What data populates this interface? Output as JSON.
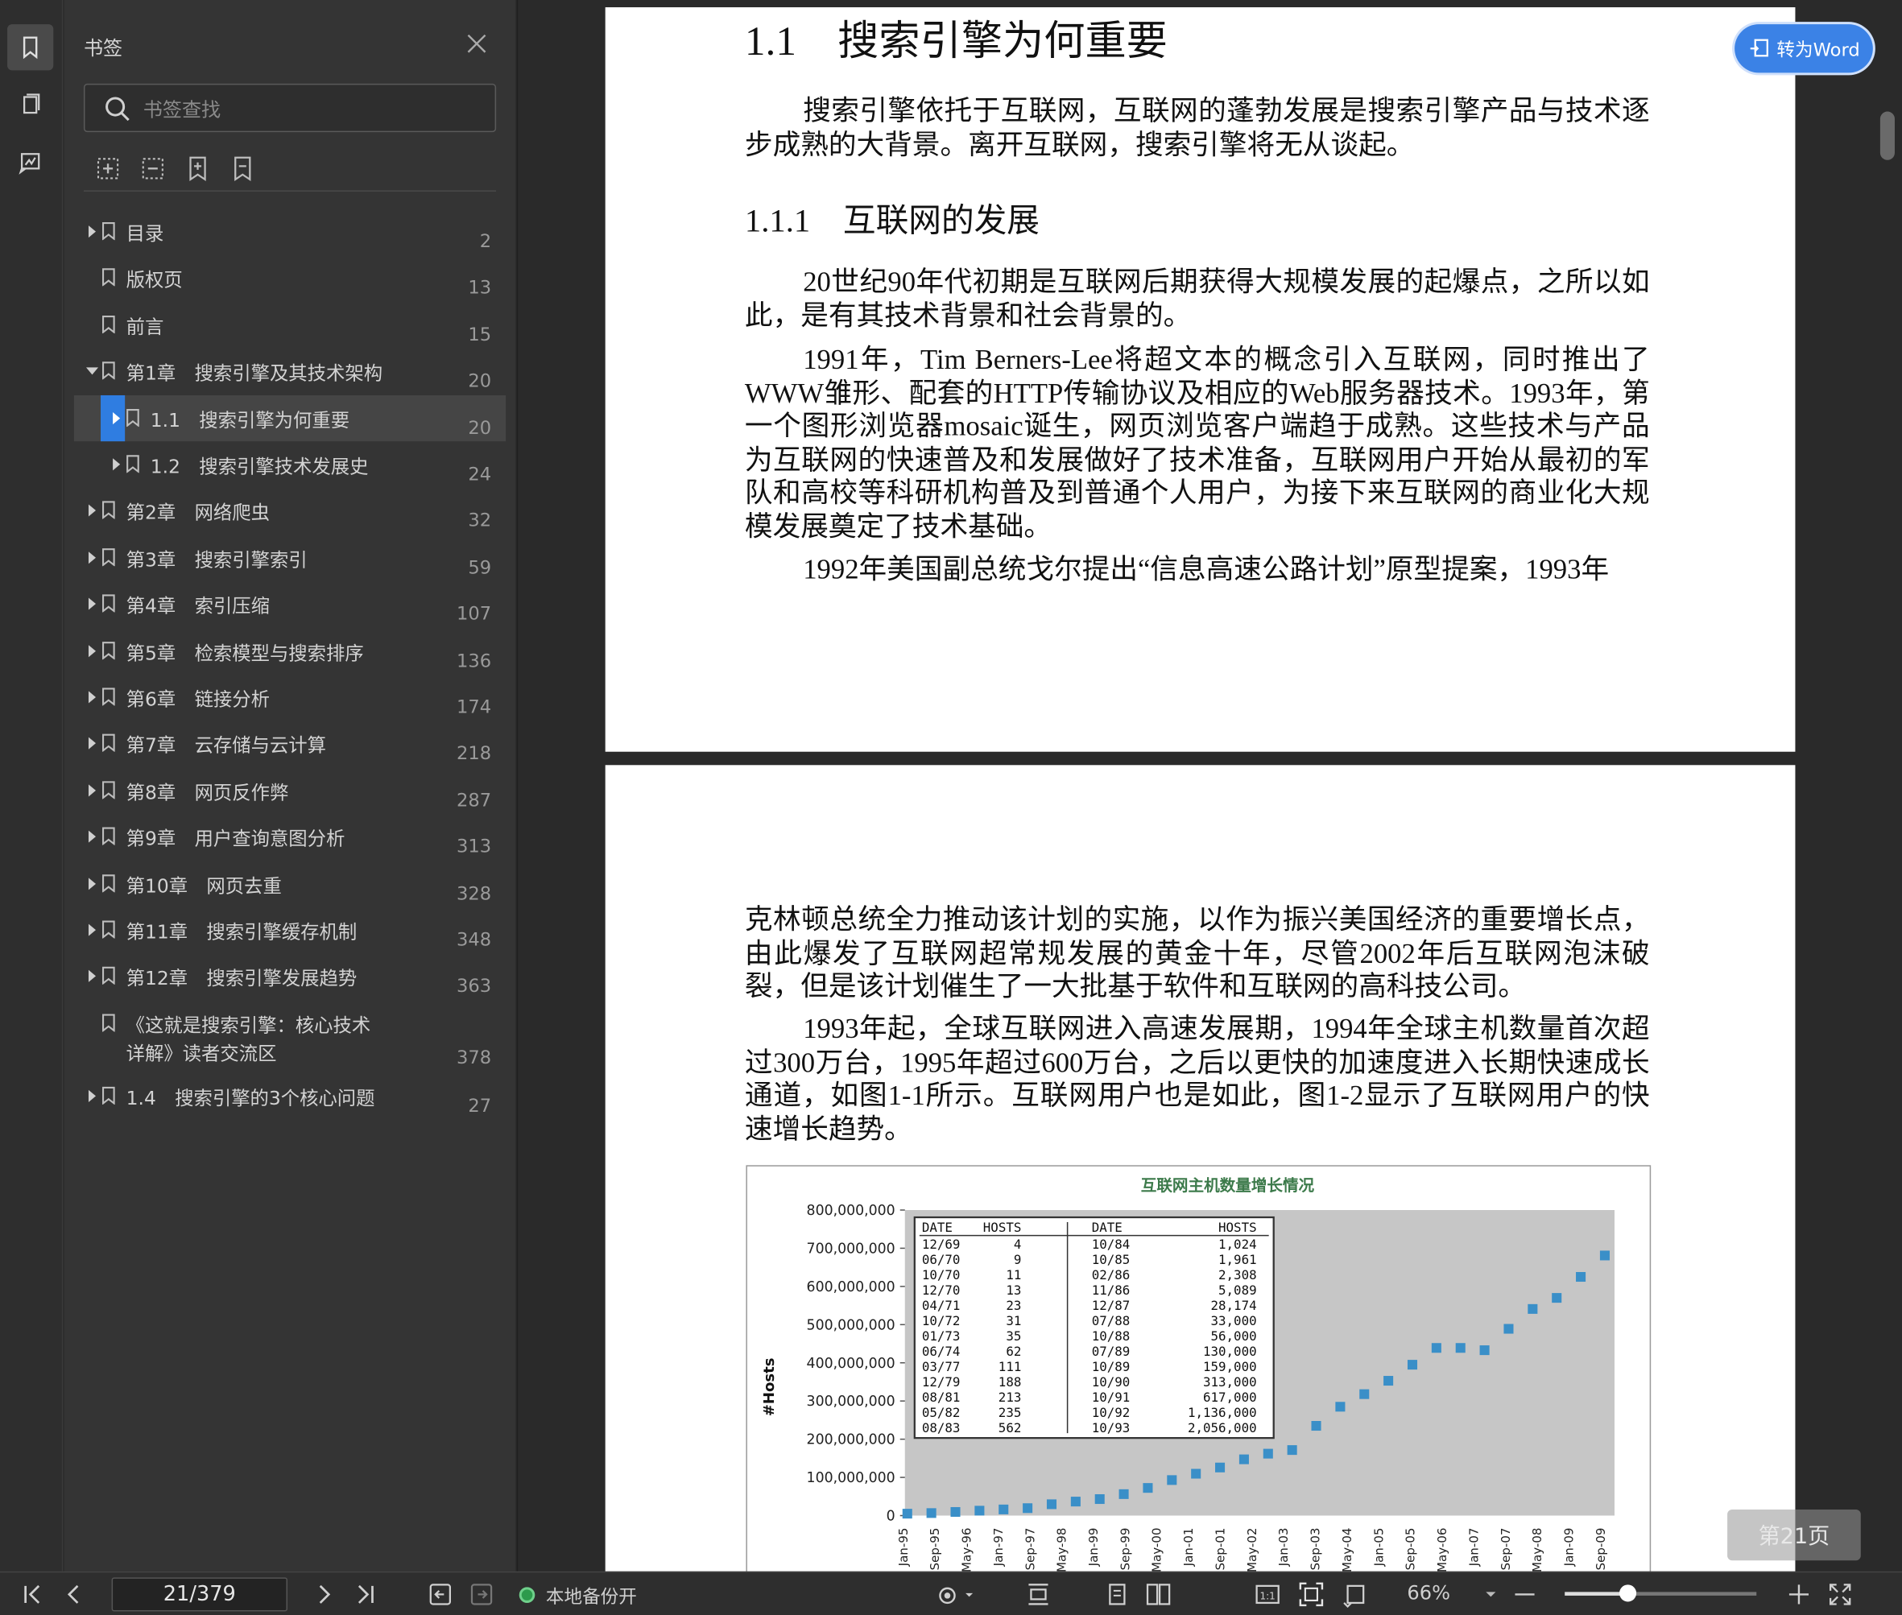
{
  "sidebar": {
    "title": "书签",
    "search_placeholder": "书签查找",
    "items": [
      {
        "label": "目录",
        "page": "2",
        "level": 0,
        "expand": "collapsed"
      },
      {
        "label": "版权页",
        "page": "13",
        "level": 0,
        "expand": "none"
      },
      {
        "label": "前言",
        "page": "15",
        "level": 0,
        "expand": "none"
      },
      {
        "label": "第1章　搜索引擎及其技术架构",
        "page": "20",
        "level": 0,
        "expand": "expanded"
      },
      {
        "label": "1.1　搜索引擎为何重要",
        "page": "20",
        "level": 1,
        "expand": "collapsed",
        "selected": true
      },
      {
        "label": "1.2　搜索引擎技术发展史",
        "page": "24",
        "level": 1,
        "expand": "collapsed"
      },
      {
        "label": "第2章　网络爬虫",
        "page": "32",
        "level": 0,
        "expand": "collapsed"
      },
      {
        "label": "第3章　搜索引擎索引",
        "page": "59",
        "level": 0,
        "expand": "collapsed"
      },
      {
        "label": "第4章　索引压缩",
        "page": "107",
        "level": 0,
        "expand": "collapsed"
      },
      {
        "label": "第5章　检索模型与搜索排序",
        "page": "136",
        "level": 0,
        "expand": "collapsed"
      },
      {
        "label": "第6章　链接分析",
        "page": "174",
        "level": 0,
        "expand": "collapsed"
      },
      {
        "label": "第7章　云存储与云计算",
        "page": "218",
        "level": 0,
        "expand": "collapsed"
      },
      {
        "label": "第8章　网页反作弊",
        "page": "287",
        "level": 0,
        "expand": "collapsed"
      },
      {
        "label": "第9章　用户查询意图分析",
        "page": "313",
        "level": 0,
        "expand": "collapsed"
      },
      {
        "label": "第10章　网页去重",
        "page": "328",
        "level": 0,
        "expand": "collapsed"
      },
      {
        "label": "第11章　搜索引擎缓存机制",
        "page": "348",
        "level": 0,
        "expand": "collapsed"
      },
      {
        "label": "第12章　搜索引擎发展趋势",
        "page": "363",
        "level": 0,
        "expand": "collapsed"
      },
      {
        "label": "《这就是搜索引擎：核心技术",
        "label2": "详解》读者交流区",
        "page": "378",
        "level": 0,
        "expand": "none"
      },
      {
        "label": "1.4　搜索引擎的3个核心问题",
        "page": "27",
        "level": 0,
        "expand": "collapsed"
      }
    ]
  },
  "document": {
    "heading1": "1.1　搜索引擎为何重要",
    "p1": "搜索引擎依托于互联网，互联网的蓬勃发展是搜索引擎产品与技术逐步成熟的大背景。离开互联网，搜索引擎将无从谈起。",
    "heading2": "1.1.1　互联网的发展",
    "p2": "20世纪90年代初期是互联网后期获得大规模发展的起爆点，之所以如此，是有其技术背景和社会背景的。",
    "p3": "1991年，Tim Berners-Lee将超文本的概念引入互联网，同时推出了WWW雏形、配套的HTTP传输协议及相应的Web服务器技术。1993年，第一个图形浏览器mosaic诞生，网页浏览客户端趋于成熟。这些技术与产品为互联网的快速普及和发展做好了技术准备，互联网用户开始从最初的军队和高校等科研机构普及到普通个人用户，为接下来互联网的商业化大规模发展奠定了技术基础。",
    "p4": "1992年美国副总统戈尔提出“信息高速公路计划”原型提案，1993年",
    "p5": "克林顿总统全力推动该计划的实施，以作为振兴美国经济的重要增长点，由此爆发了互联网超常规发展的黄金十年，尽管2002年后互联网泡沫破裂，但是该计划催生了一大批基于软件和互联网的高科技公司。",
    "p6": "1993年起，全球互联网进入高速发展期，1994年全球主机数量首次超过300万台，1995年超过600万台，之后以更快的加速度进入长期快速成长通道，如图1-1所示。互联网用户也是如此，图1-2显示了互联网用户的快速增长趋势。"
  },
  "chart": {
    "title": "互联网主机数量增长情况",
    "ylabel": "#Hosts",
    "yticks": [
      "800,000,000",
      "700,000,000",
      "600,000,000",
      "500,000,000",
      "400,000,000",
      "300,000,000",
      "200,000,000",
      "100,000,000",
      "0"
    ],
    "xticks": [
      "Jan-95",
      "Sep-95",
      "May-96",
      "Jan-97",
      "Sep-97",
      "May-98",
      "Jan-99",
      "Sep-99",
      "May-00",
      "Jan-01",
      "Sep-01",
      "May-02",
      "Jan-03",
      "Sep-03",
      "May-04",
      "Jan-05",
      "Sep-05",
      "May-06",
      "Jan-07",
      "Sep-07",
      "May-08",
      "Jan-09",
      "Sep-09"
    ],
    "table_header": [
      "DATE",
      "HOSTS",
      "DATE",
      "HOSTS"
    ],
    "table_rows": [
      [
        "12/69",
        "4",
        "10/84",
        "1,024"
      ],
      [
        "06/70",
        "9",
        "10/85",
        "1,961"
      ],
      [
        "10/70",
        "11",
        "02/86",
        "2,308"
      ],
      [
        "12/70",
        "13",
        "11/86",
        "5,089"
      ],
      [
        "04/71",
        "23",
        "12/87",
        "28,174"
      ],
      [
        "10/72",
        "31",
        "07/88",
        "33,000"
      ],
      [
        "01/73",
        "35",
        "10/88",
        "56,000"
      ],
      [
        "06/74",
        "62",
        "07/89",
        "130,000"
      ],
      [
        "03/77",
        "111",
        "10/89",
        "159,000"
      ],
      [
        "12/79",
        "188",
        "10/90",
        "313,000"
      ],
      [
        "08/81",
        "213",
        "10/91",
        "617,000"
      ],
      [
        "05/82",
        "235",
        "10/92",
        "1,136,000"
      ],
      [
        "08/83",
        "562",
        "10/93",
        "2,056,000"
      ]
    ],
    "color": "#3a8fc8"
  },
  "chart_data": {
    "type": "scatter",
    "title": "互联网主机数量增长情况",
    "ylabel": "#Hosts",
    "ylim": [
      0,
      800000000
    ],
    "x": [
      "Jan-95",
      "Jul-95",
      "Jan-96",
      "Jul-96",
      "Jan-97",
      "Jul-97",
      "Jan-98",
      "Jul-98",
      "Jan-99",
      "Jul-99",
      "Jan-00",
      "Jul-00",
      "Jan-01",
      "Jul-01",
      "Jan-02",
      "Jul-02",
      "Jan-03",
      "Jul-03",
      "Jan-04",
      "Jul-04",
      "Jan-05",
      "Jul-05",
      "Jan-06",
      "Jul-06",
      "Jan-07",
      "Jul-07",
      "Jan-08",
      "Jul-08",
      "Jan-09",
      "Jul-09"
    ],
    "y": [
      5000000,
      6600000,
      9500000,
      12900000,
      16100000,
      19500000,
      29700000,
      36700000,
      43200000,
      56200000,
      72400000,
      93000000,
      109600000,
      125900000,
      147300000,
      162100000,
      171600000,
      235000000,
      285000000,
      318000000,
      353000000,
      395000000,
      439000000,
      439000000,
      433000000,
      489000000,
      541000000,
      570000000,
      625000000,
      681000000
    ]
  },
  "ui": {
    "convert_label": "转为Word",
    "page_badge": "第21页",
    "page_input": "21/379",
    "backup_label": "本地备份开",
    "zoom_label": "66%",
    "zoom_fraction": 0.33
  }
}
